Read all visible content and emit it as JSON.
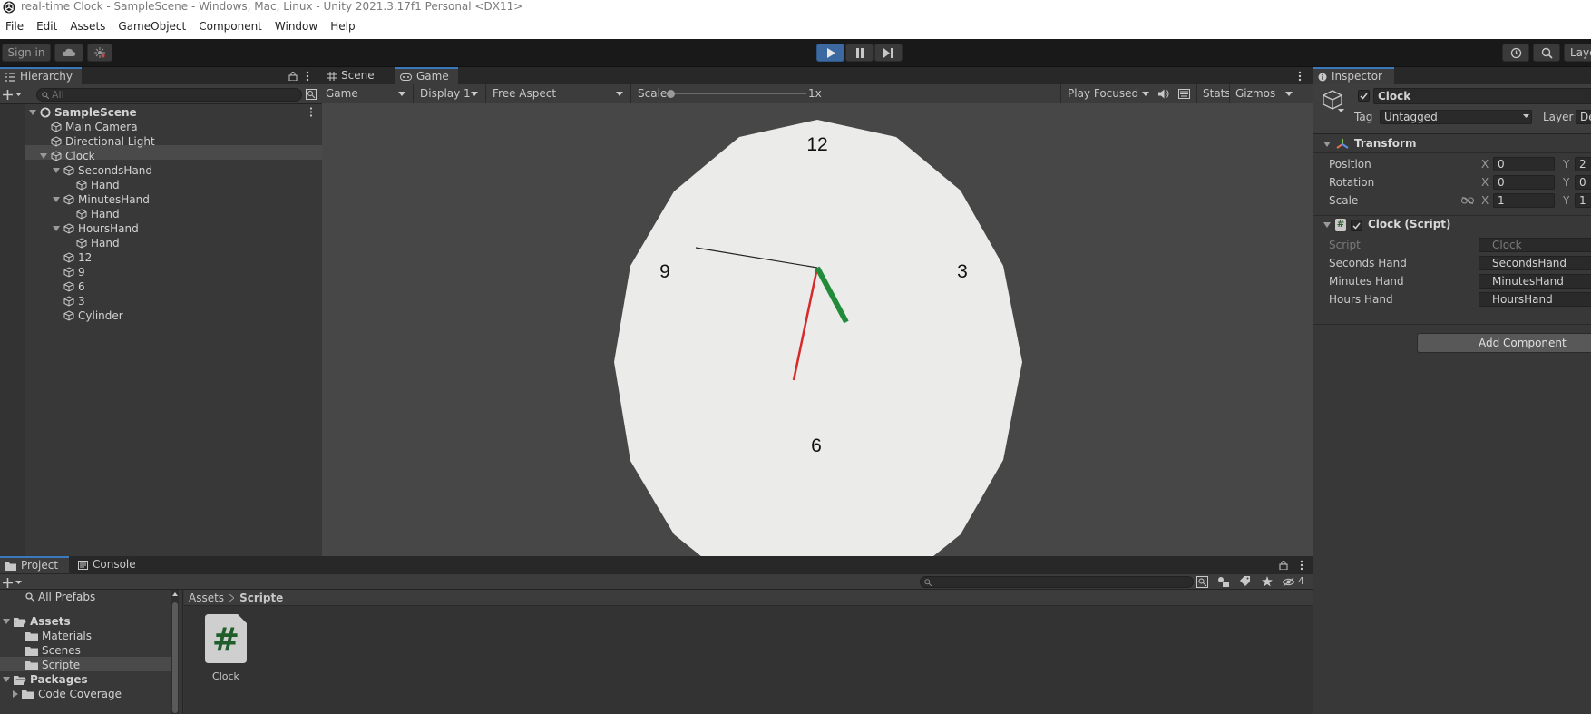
{
  "window": {
    "title": "real-time Clock - SampleScene - Windows, Mac, Linux - Unity 2021.3.17f1 Personal <DX11>"
  },
  "menu": [
    "File",
    "Edit",
    "Assets",
    "GameObject",
    "Component",
    "Window",
    "Help"
  ],
  "toolbar": {
    "sign_in": "Sign in",
    "layers": "Laye",
    "play_icon": "play-icon",
    "pause_icon": "pause-icon",
    "step_icon": "step-icon"
  },
  "hierarchy": {
    "tab": "Hierarchy",
    "search_placeholder": "All",
    "items": [
      {
        "label": "SampleScene",
        "bold": true
      },
      {
        "label": "Main Camera"
      },
      {
        "label": "Directional Light"
      },
      {
        "label": "Clock",
        "selected": true
      },
      {
        "label": "SecondsHand"
      },
      {
        "label": "Hand"
      },
      {
        "label": "MinutesHand"
      },
      {
        "label": "Hand"
      },
      {
        "label": "HoursHand"
      },
      {
        "label": "Hand"
      },
      {
        "label": "12"
      },
      {
        "label": "9"
      },
      {
        "label": "6"
      },
      {
        "label": "3"
      },
      {
        "label": "Cylinder"
      }
    ]
  },
  "game": {
    "tabs": [
      "Scene",
      "Game"
    ],
    "selected_tab": "Game",
    "toolbar": {
      "view": "Game",
      "display": "Display 1",
      "aspect": "Free Aspect",
      "scale_label": "Scale",
      "scale_value": "1x",
      "play_mode": "Play Focused",
      "stats": "Stats",
      "gizmos": "Gizmos"
    },
    "clock": {
      "numbers": [
        "12",
        "3",
        "6",
        "9"
      ],
      "face_color": "#ebebea",
      "seconds_color": "#222222",
      "minutes_color": "#d62a2a",
      "hours_color": "#228b3a"
    },
    "background": "#474747"
  },
  "inspector": {
    "tab": "Inspector",
    "object_name": "Clock",
    "tag_label": "Tag",
    "tag_value": "Untagged",
    "layer_label": "Layer",
    "layer_value": "De",
    "transform": {
      "title": "Transform",
      "rows": [
        {
          "label": "Position",
          "x": "0",
          "y": "2"
        },
        {
          "label": "Rotation",
          "x": "0",
          "y": "0"
        },
        {
          "label": "Scale",
          "x": "1",
          "y": "1"
        }
      ]
    },
    "script": {
      "title": "Clock (Script)",
      "rows": [
        {
          "label": "Script",
          "value": "Clock"
        },
        {
          "label": "Seconds Hand",
          "value": "SecondsHand"
        },
        {
          "label": "Minutes Hand",
          "value": "MinutesHand"
        },
        {
          "label": "Hours Hand",
          "value": "HoursHand"
        }
      ]
    },
    "add_component": "Add Component"
  },
  "project": {
    "tabs": [
      "Project",
      "Console"
    ],
    "hidden_count": "4",
    "tree": [
      {
        "label": "All Prefabs"
      },
      {
        "label": "Assets",
        "bold": true
      },
      {
        "label": "Materials"
      },
      {
        "label": "Scenes"
      },
      {
        "label": "Scripte",
        "selected": true
      },
      {
        "label": "Packages",
        "bold": true
      },
      {
        "label": "Code Coverage"
      }
    ],
    "breadcrumb": [
      "Assets",
      "Scripte"
    ],
    "assets": [
      {
        "label": "Clock",
        "icon": "csharp-script-icon",
        "symbol": "#"
      }
    ]
  },
  "xyz": {
    "x": "X",
    "y": "Y"
  }
}
